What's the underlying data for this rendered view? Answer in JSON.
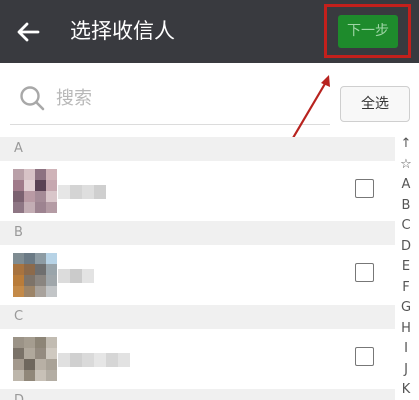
{
  "header": {
    "title": "选择收信人",
    "next_label": "下一步"
  },
  "search": {
    "placeholder": "搜索",
    "select_all_label": "全选"
  },
  "sections": [
    {
      "letter": "A"
    },
    {
      "letter": "B"
    },
    {
      "letter": "C"
    },
    {
      "letter": "D"
    }
  ],
  "index": [
    "↑",
    "☆",
    "A",
    "B",
    "C",
    "D",
    "E",
    "F",
    "G",
    "H",
    "I",
    "J",
    "K"
  ],
  "colors": {
    "header_bg": "#393a3f",
    "accent": "#1e8b2c",
    "highlight": "#c4201c"
  }
}
